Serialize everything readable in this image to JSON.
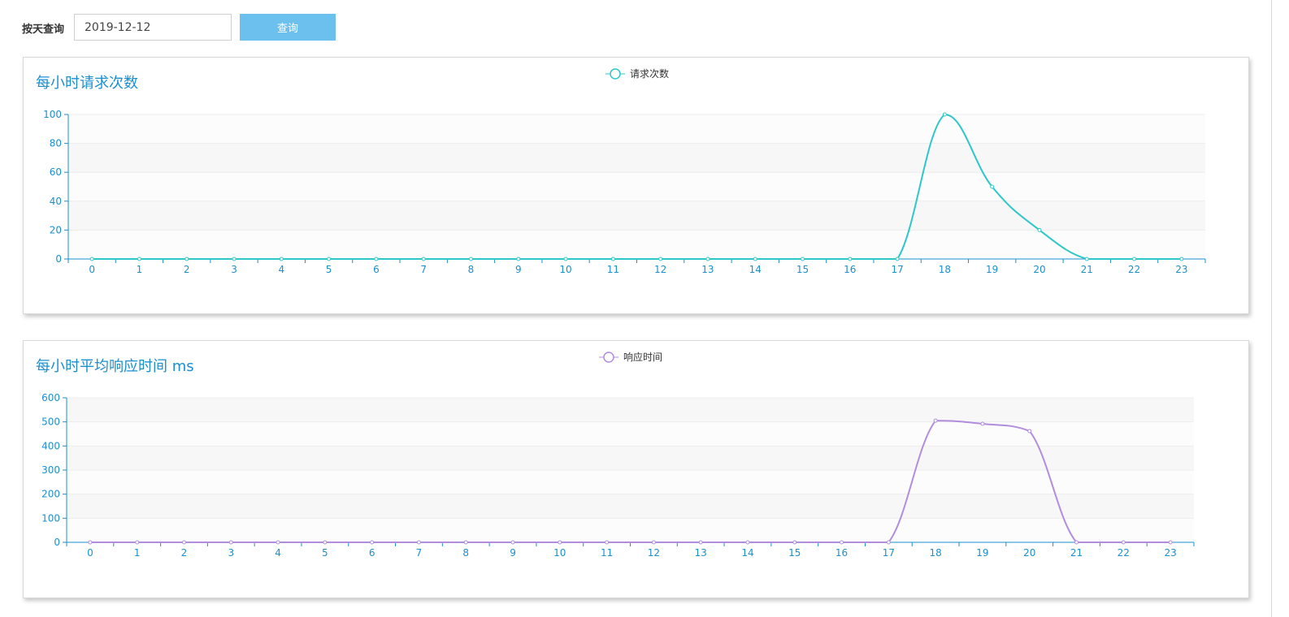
{
  "query": {
    "label": "按天查询",
    "date_value": "2019-12-12",
    "button_label": "查询"
  },
  "colors": {
    "title": "#1b8fd0",
    "axis": "#1b8fd0",
    "requests_series": "#2ec7c9",
    "response_series": "#b28ddd",
    "button": "#6cc0ed"
  },
  "chart_data": [
    {
      "type": "line",
      "title": "每小时请求次数",
      "legend_position": "top-center",
      "smooth": true,
      "grid": true,
      "x": [
        "0",
        "1",
        "2",
        "3",
        "4",
        "5",
        "6",
        "7",
        "8",
        "9",
        "10",
        "11",
        "12",
        "13",
        "14",
        "15",
        "16",
        "17",
        "18",
        "19",
        "20",
        "21",
        "22",
        "23"
      ],
      "ylim": [
        0,
        100
      ],
      "yticks": [
        0,
        20,
        40,
        60,
        80,
        100
      ],
      "series": [
        {
          "name": "请求次数",
          "values": [
            0,
            0,
            0,
            0,
            0,
            0,
            0,
            0,
            0,
            0,
            0,
            0,
            0,
            0,
            0,
            0,
            0,
            0,
            100,
            50,
            20,
            0,
            0,
            0
          ]
        }
      ]
    },
    {
      "type": "line",
      "title": "每小时平均响应时间 ms",
      "legend_position": "top-center",
      "smooth": true,
      "grid": true,
      "x": [
        "0",
        "1",
        "2",
        "3",
        "4",
        "5",
        "6",
        "7",
        "8",
        "9",
        "10",
        "11",
        "12",
        "13",
        "14",
        "15",
        "16",
        "17",
        "18",
        "19",
        "20",
        "21",
        "22",
        "23"
      ],
      "ylim": [
        0,
        600
      ],
      "yticks": [
        0,
        100,
        200,
        300,
        400,
        500,
        600
      ],
      "series": [
        {
          "name": "响应时间",
          "values": [
            0,
            0,
            0,
            0,
            0,
            0,
            0,
            0,
            0,
            0,
            0,
            0,
            0,
            0,
            0,
            0,
            0,
            0,
            505,
            492,
            462,
            0,
            0,
            0
          ]
        }
      ]
    }
  ]
}
